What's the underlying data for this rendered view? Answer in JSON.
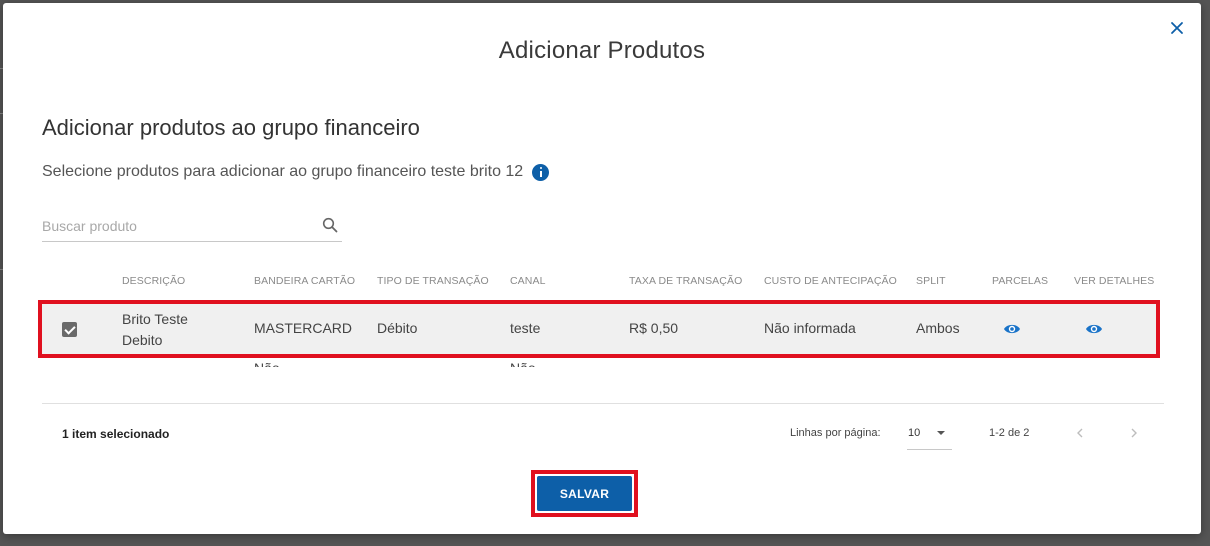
{
  "dialog": {
    "title": "Adicionar Produtos",
    "section_title": "Adicionar produtos ao grupo financeiro",
    "subtitle": "Selecione produtos para adicionar ao grupo financeiro teste brito 12"
  },
  "search": {
    "placeholder": "Buscar produto",
    "value": ""
  },
  "table": {
    "headers": [
      "DESCRIÇÃO",
      "BANDEIRA CARTÃO",
      "TIPO DE TRANSAÇÃO",
      "CANAL",
      "TAXA DE TRANSAÇÃO",
      "CUSTO DE ANTECIPAÇÃO",
      "SPLIT",
      "PARCELAS",
      "VER DETALHES"
    ],
    "rows": [
      {
        "selected": true,
        "descricao_line1": "Brito Teste",
        "descricao_line2": "Debito",
        "bandeira": "MASTERCARD",
        "tipo": "Débito",
        "canal": "teste",
        "taxa": "R$ 0,50",
        "custo": "Não informada",
        "split": "Ambos",
        "parcelas_icon": "eye-icon",
        "detalhes_icon": "eye-icon"
      }
    ],
    "partial_row": {
      "bandeira": "Não",
      "canal": "Não"
    }
  },
  "footer": {
    "selected_text": "1 item selecionado",
    "rows_per_page_label": "Linhas por página:",
    "rows_per_page_value": "10",
    "range_text": "1-2 de 2"
  },
  "actions": {
    "save_label": "SALVAR"
  },
  "colors": {
    "primary": "#0d5fa8",
    "highlight": "#e0101f",
    "selected_row": "#f0f0f0"
  }
}
